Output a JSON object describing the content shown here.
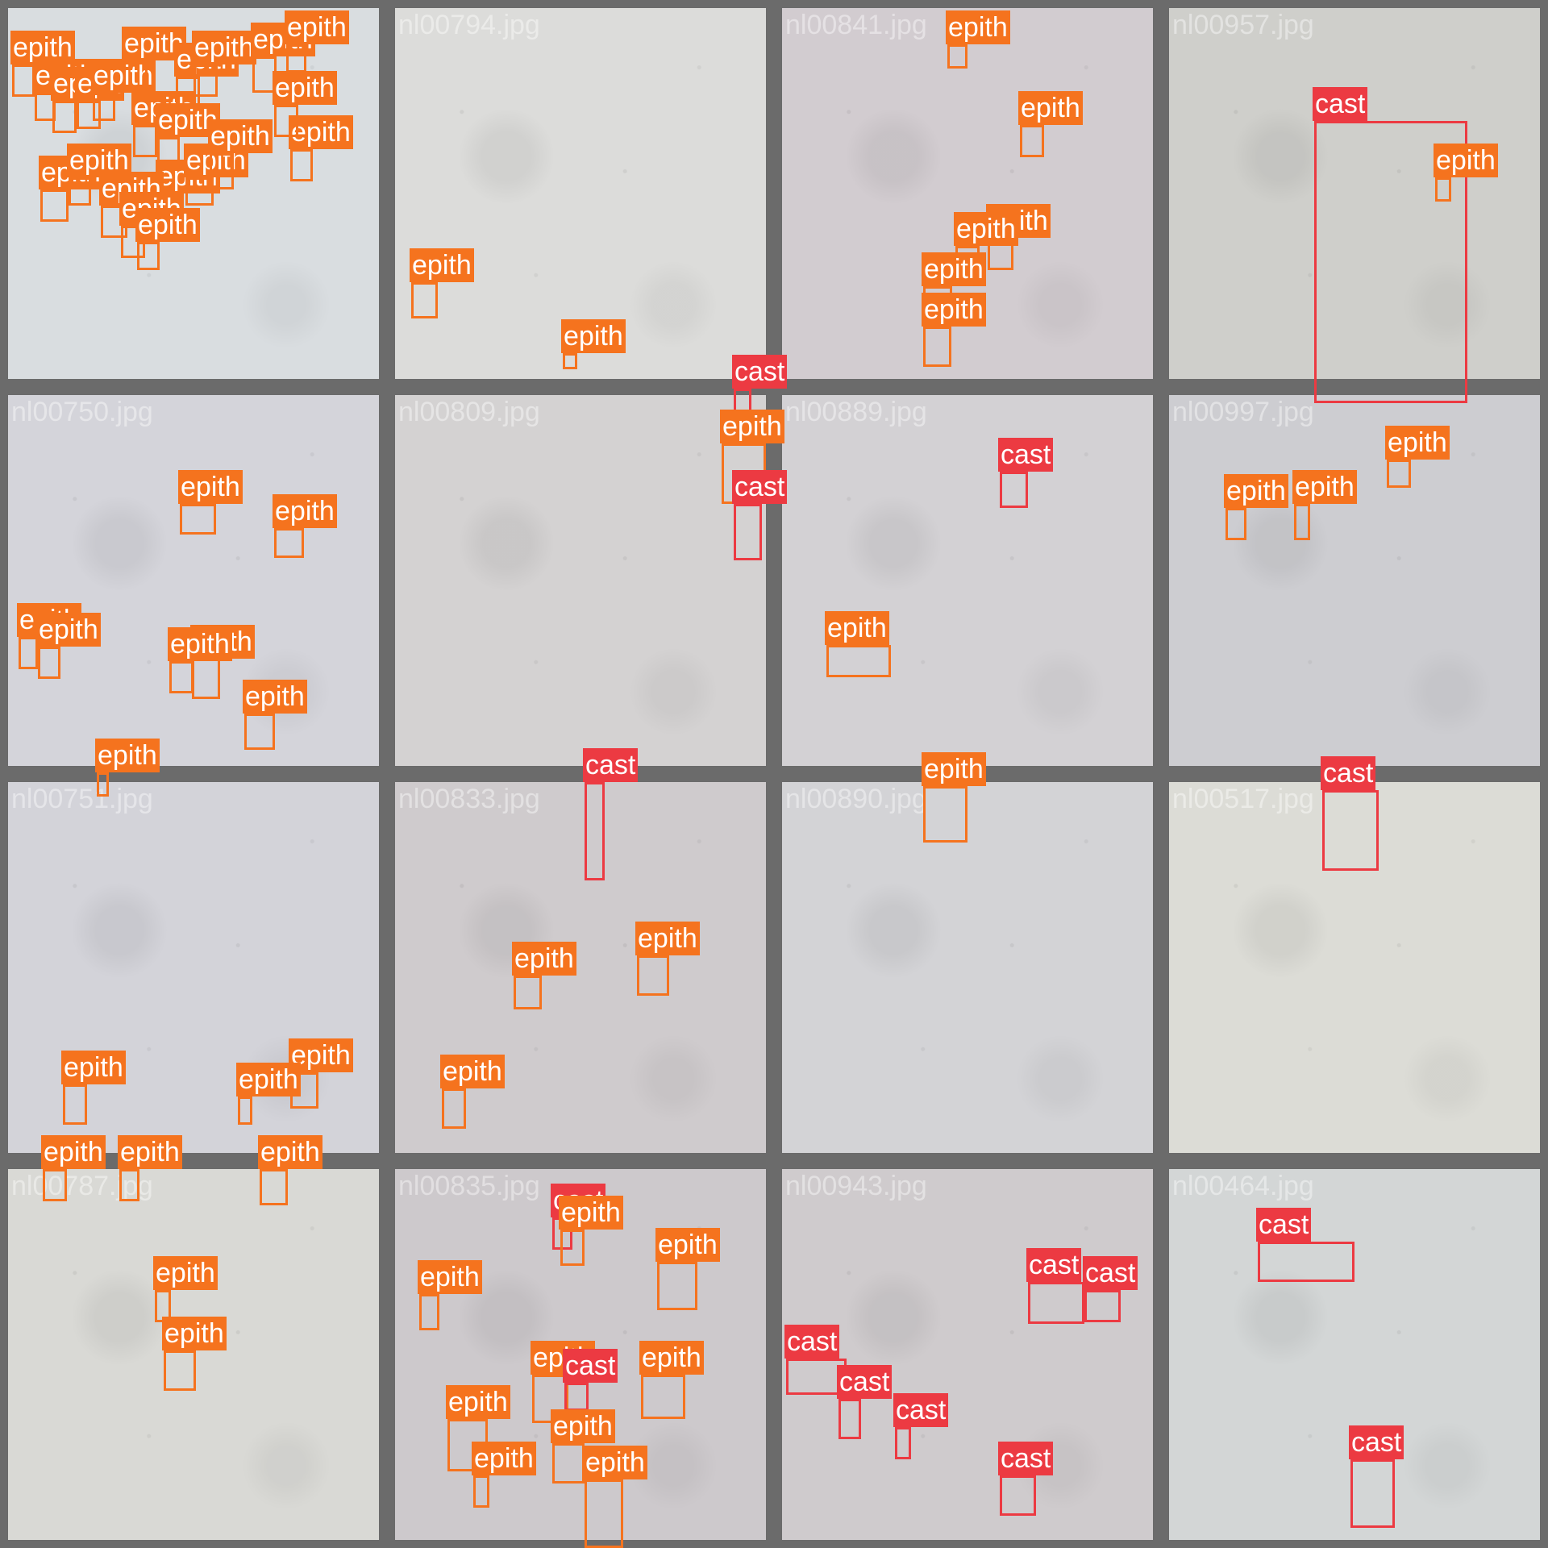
{
  "class_colors": {
    "epith": "#f5731e",
    "cast": "#ec3a42"
  },
  "tiles": [
    {
      "file": "",
      "bg": "#d9dde0",
      "labels": [
        {
          "cls": "epith",
          "text": "epith"
        },
        {
          "cls": "epith",
          "text": "epith"
        },
        {
          "cls": "epith",
          "text": "epith"
        },
        {
          "cls": "epith",
          "text": "epit"
        },
        {
          "cls": "epith",
          "text": "epith"
        },
        {
          "cls": "epith",
          "text": "epith"
        },
        {
          "cls": "epith",
          "text": "epith"
        },
        {
          "cls": "epith",
          "text": "epith"
        },
        {
          "cls": "epith",
          "text": "epith"
        },
        {
          "cls": "epith",
          "text": "epith"
        },
        {
          "cls": "epith",
          "text": "epith"
        },
        {
          "cls": "epith",
          "text": "epith"
        },
        {
          "cls": "epith",
          "text": "epith"
        },
        {
          "cls": "epith",
          "text": "epith"
        },
        {
          "cls": "epith",
          "text": "epith"
        },
        {
          "cls": "epith",
          "text": "epith"
        },
        {
          "cls": "epith",
          "text": "epith"
        },
        {
          "cls": "epith",
          "text": "epith"
        },
        {
          "cls": "epith",
          "text": "epith"
        },
        {
          "cls": "epith",
          "text": "epith"
        },
        {
          "cls": "epith",
          "text": "epith"
        },
        {
          "cls": "epith",
          "text": "epith"
        }
      ]
    },
    {
      "file": "nl00794.jpg",
      "bg": "#dcdcda",
      "labels": [
        {
          "cls": "epith",
          "text": "epith"
        },
        {
          "cls": "epith",
          "text": "epith"
        }
      ]
    },
    {
      "file": "nl00841.jpg",
      "bg": "#d2ccd0",
      "labels": [
        {
          "cls": "epith",
          "text": "epith"
        },
        {
          "cls": "epith",
          "text": "epith"
        },
        {
          "cls": "epith",
          "text": "epith"
        },
        {
          "cls": "epith",
          "text": "epith"
        },
        {
          "cls": "epith",
          "text": "epith"
        },
        {
          "cls": "epith",
          "text": "epith"
        }
      ]
    },
    {
      "file": "nl00957.jpg",
      "bg": "#cfcfcb",
      "labels": [
        {
          "cls": "cast",
          "text": "cast"
        },
        {
          "cls": "epith",
          "text": "epith"
        }
      ]
    },
    {
      "file": "nl00750.jpg",
      "bg": "#d4d4da",
      "labels": [
        {
          "cls": "epith",
          "text": "epith"
        },
        {
          "cls": "epith",
          "text": "epith"
        },
        {
          "cls": "epith",
          "text": "epith"
        },
        {
          "cls": "epith",
          "text": "epith"
        },
        {
          "cls": "epith",
          "text": "epith"
        },
        {
          "cls": "epith",
          "text": "epith"
        },
        {
          "cls": "epith",
          "text": "epith"
        }
      ]
    },
    {
      "file": "nl00809.jpg",
      "bg": "#d4d2d2",
      "labels": [
        {
          "cls": "cast",
          "text": "cast"
        },
        {
          "cls": "epith",
          "text": "epith"
        },
        {
          "cls": "cast",
          "text": "cast"
        }
      ]
    },
    {
      "file": "nl00889.jpg",
      "bg": "#d3d1d4",
      "labels": [
        {
          "cls": "epith",
          "text": "epith"
        },
        {
          "cls": "cast",
          "text": "cast"
        }
      ]
    },
    {
      "file": "nl00997.jpg",
      "bg": "#cdcdd1",
      "labels": [
        {
          "cls": "epith",
          "text": "epith"
        },
        {
          "cls": "epith",
          "text": "epith"
        },
        {
          "cls": "epith",
          "text": "epith"
        }
      ]
    },
    {
      "file": "nl00751.jpg",
      "bg": "#d3d3d9",
      "labels": [
        {
          "cls": "epith",
          "text": "epith"
        },
        {
          "cls": "epith",
          "text": "epith"
        },
        {
          "cls": "epith",
          "text": "epith"
        },
        {
          "cls": "epith",
          "text": "epith"
        },
        {
          "cls": "epith",
          "text": "epith"
        },
        {
          "cls": "epith",
          "text": "epith"
        },
        {
          "cls": "epith",
          "text": "epith"
        }
      ]
    },
    {
      "file": "nl00833.jpg",
      "bg": "#cfcbcd",
      "labels": [
        {
          "cls": "cast",
          "text": "cast"
        },
        {
          "cls": "epith",
          "text": "epith"
        },
        {
          "cls": "epith",
          "text": "epith"
        },
        {
          "cls": "epith",
          "text": "epith"
        }
      ]
    },
    {
      "file": "nl00890.jpg",
      "bg": "#d3d3d6",
      "labels": [
        {
          "cls": "epith",
          "text": "epith"
        }
      ]
    },
    {
      "file": "nl00517.jpg",
      "bg": "#dcdcd6",
      "labels": [
        {
          "cls": "cast",
          "text": "cast"
        }
      ]
    },
    {
      "file": "nl00787.jpg",
      "bg": "#d9d9d5",
      "labels": [
        {
          "cls": "epith",
          "text": "epith"
        },
        {
          "cls": "epith",
          "text": "epith"
        }
      ]
    },
    {
      "file": "nl00835.jpg",
      "bg": "#cdc9cc",
      "labels": [
        {
          "cls": "cast",
          "text": "cast"
        },
        {
          "cls": "epith",
          "text": "epith"
        },
        {
          "cls": "epith",
          "text": "epith"
        },
        {
          "cls": "epith",
          "text": "epith"
        },
        {
          "cls": "epith",
          "text": "epith"
        },
        {
          "cls": "epith",
          "text": "epith"
        },
        {
          "cls": "cast",
          "text": "cast"
        },
        {
          "cls": "epith",
          "text": "epith"
        },
        {
          "cls": "epith",
          "text": "epith"
        },
        {
          "cls": "epith",
          "text": "epith"
        },
        {
          "cls": "epith",
          "text": "epith"
        }
      ]
    },
    {
      "file": "nl00943.jpg",
      "bg": "#cfcbcd",
      "labels": [
        {
          "cls": "cast",
          "text": "cast"
        },
        {
          "cls": "cast",
          "text": "cast"
        },
        {
          "cls": "cast",
          "text": "cast"
        },
        {
          "cls": "cast",
          "text": "cast"
        },
        {
          "cls": "cast",
          "text": "cast"
        },
        {
          "cls": "cast",
          "text": "cast"
        }
      ]
    },
    {
      "file": "nl00464.jpg",
      "bg": "#d3d6d6",
      "labels": [
        {
          "cls": "cast",
          "text": "cast"
        },
        {
          "cls": "cast",
          "text": "cast"
        }
      ]
    }
  ]
}
